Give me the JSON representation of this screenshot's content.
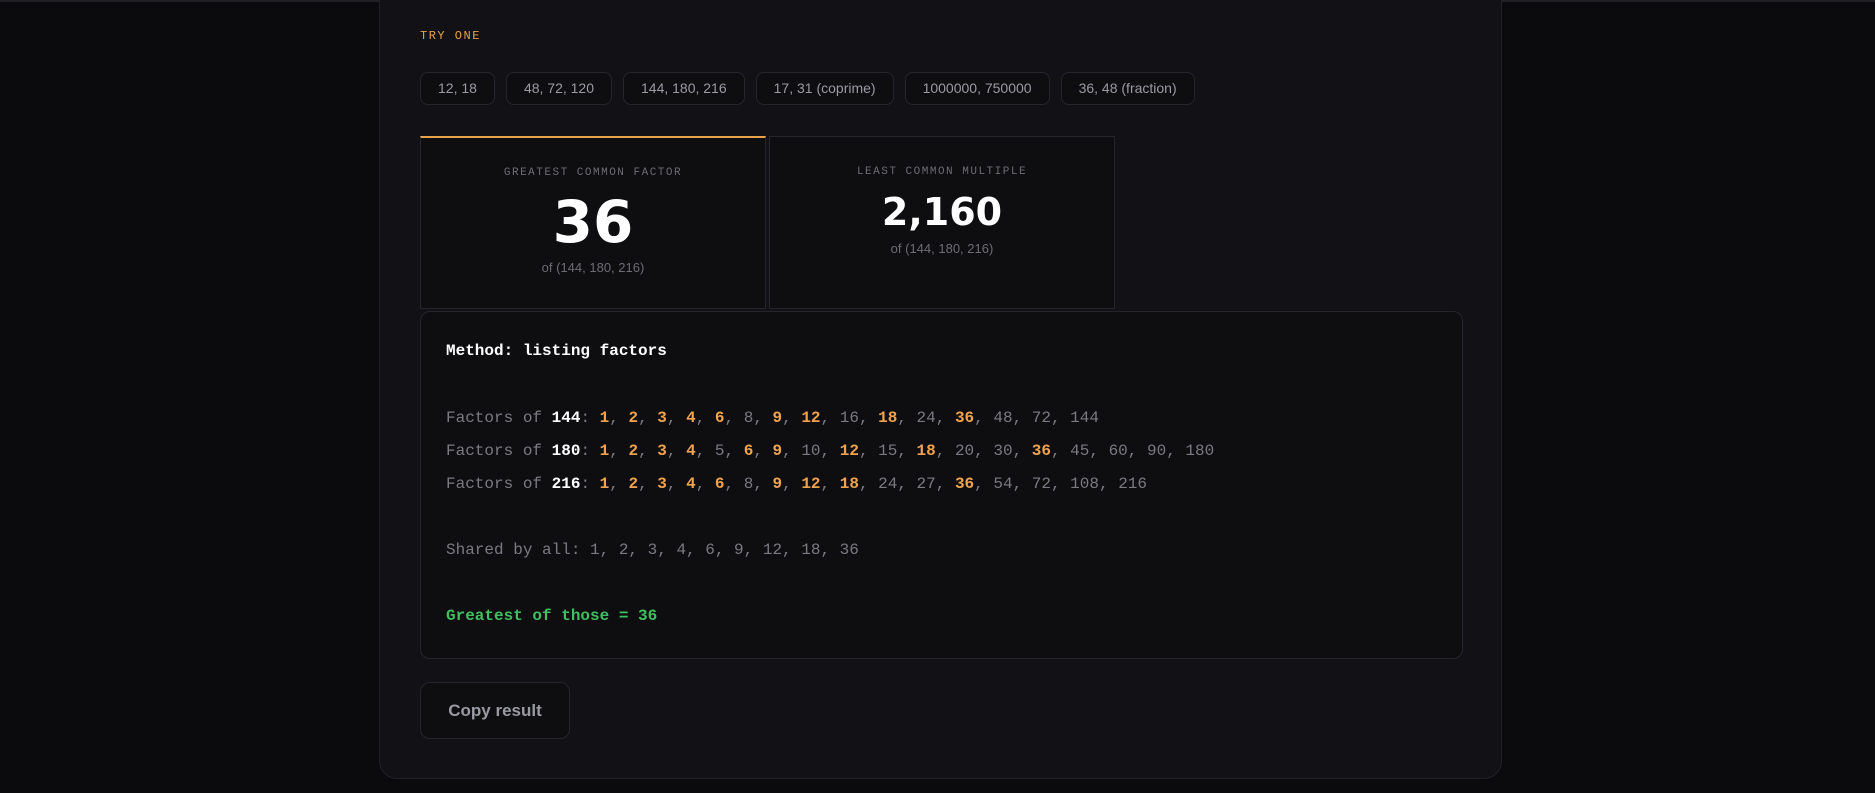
{
  "try_label": "TRY ONE",
  "examples": [
    "12, 18",
    "48, 72, 120",
    "144, 180, 216",
    "17, 31 (coprime)",
    "1000000, 750000",
    "36, 48 (fraction)"
  ],
  "gcf": {
    "label": "GREATEST COMMON FACTOR",
    "value": "36",
    "sub": "of (144, 180, 216)"
  },
  "lcm": {
    "label": "LEAST COMMON MULTIPLE",
    "value": "2,160",
    "sub": "of (144, 180, 216)"
  },
  "method": {
    "title": "Method: listing factors",
    "factor_prefix": "Factors of ",
    "rows": [
      {
        "number": "144",
        "factors": [
          {
            "v": "1",
            "shared": true
          },
          {
            "v": "2",
            "shared": true
          },
          {
            "v": "3",
            "shared": true
          },
          {
            "v": "4",
            "shared": true
          },
          {
            "v": "6",
            "shared": true
          },
          {
            "v": "8",
            "shared": false
          },
          {
            "v": "9",
            "shared": true
          },
          {
            "v": "12",
            "shared": true
          },
          {
            "v": "16",
            "shared": false
          },
          {
            "v": "18",
            "shared": true
          },
          {
            "v": "24",
            "shared": false
          },
          {
            "v": "36",
            "shared": true
          },
          {
            "v": "48",
            "shared": false
          },
          {
            "v": "72",
            "shared": false
          },
          {
            "v": "144",
            "shared": false
          }
        ]
      },
      {
        "number": "180",
        "factors": [
          {
            "v": "1",
            "shared": true
          },
          {
            "v": "2",
            "shared": true
          },
          {
            "v": "3",
            "shared": true
          },
          {
            "v": "4",
            "shared": true
          },
          {
            "v": "5",
            "shared": false
          },
          {
            "v": "6",
            "shared": true
          },
          {
            "v": "9",
            "shared": true
          },
          {
            "v": "10",
            "shared": false
          },
          {
            "v": "12",
            "shared": true
          },
          {
            "v": "15",
            "shared": false
          },
          {
            "v": "18",
            "shared": true
          },
          {
            "v": "20",
            "shared": false
          },
          {
            "v": "30",
            "shared": false
          },
          {
            "v": "36",
            "shared": true
          },
          {
            "v": "45",
            "shared": false
          },
          {
            "v": "60",
            "shared": false
          },
          {
            "v": "90",
            "shared": false
          },
          {
            "v": "180",
            "shared": false
          }
        ]
      },
      {
        "number": "216",
        "factors": [
          {
            "v": "1",
            "shared": true
          },
          {
            "v": "2",
            "shared": true
          },
          {
            "v": "3",
            "shared": true
          },
          {
            "v": "4",
            "shared": true
          },
          {
            "v": "6",
            "shared": true
          },
          {
            "v": "8",
            "shared": false
          },
          {
            "v": "9",
            "shared": true
          },
          {
            "v": "12",
            "shared": true
          },
          {
            "v": "18",
            "shared": true
          },
          {
            "v": "24",
            "shared": false
          },
          {
            "v": "27",
            "shared": false
          },
          {
            "v": "36",
            "shared": true
          },
          {
            "v": "54",
            "shared": false
          },
          {
            "v": "72",
            "shared": false
          },
          {
            "v": "108",
            "shared": false
          },
          {
            "v": "216",
            "shared": false
          }
        ]
      }
    ],
    "shared": "Shared by all: 1, 2, 3, 4, 6, 9, 12, 18, 36",
    "result": "Greatest of those = 36"
  },
  "copy_button": "Copy result",
  "colors": {
    "accent": "#e7a24a",
    "highlight": "#f0a24c",
    "success": "#3fbf5f",
    "background": "#0b0b0d",
    "panel": "#121216"
  }
}
